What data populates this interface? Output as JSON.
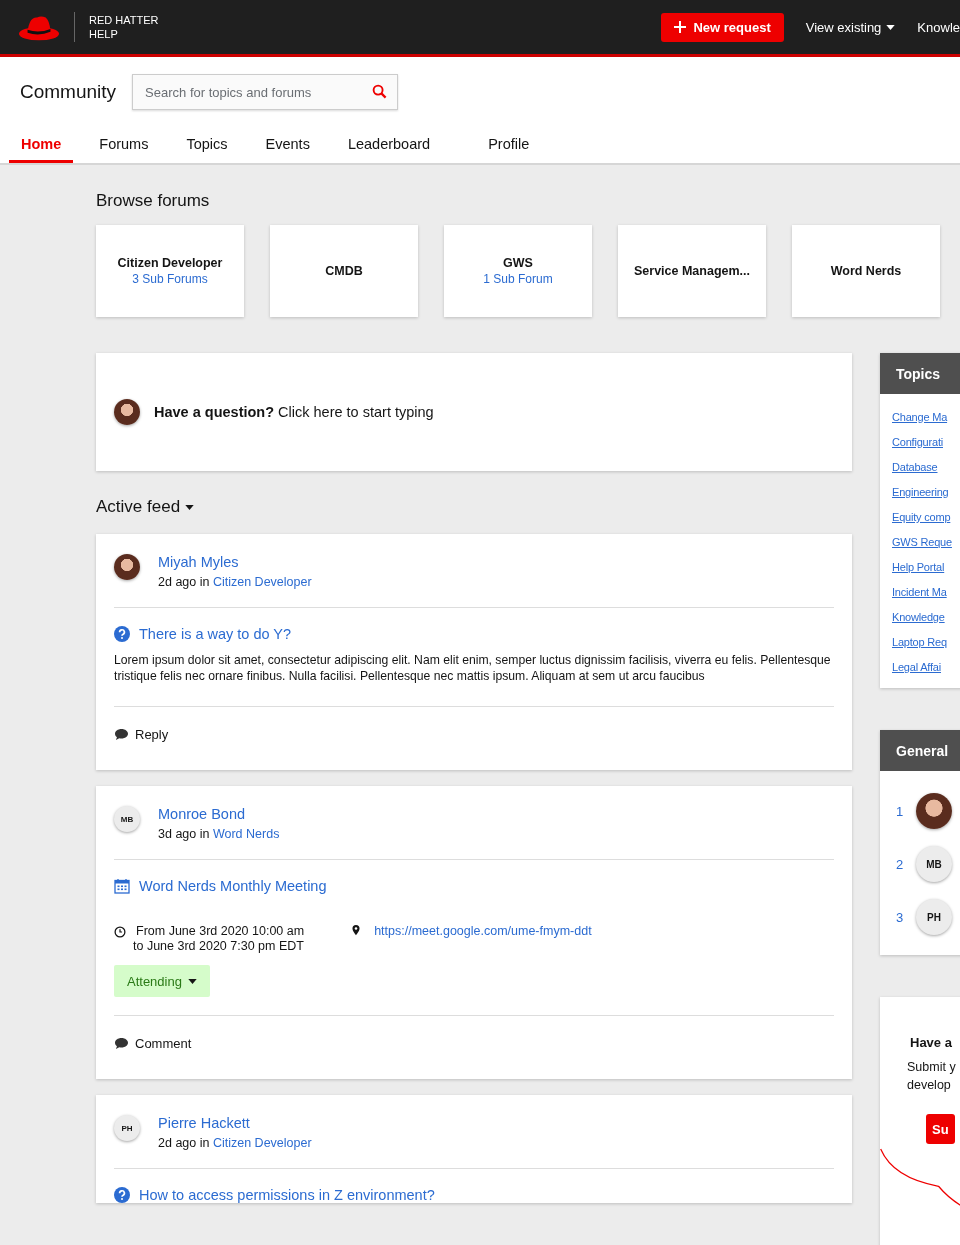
{
  "header": {
    "brand_lines": [
      "RED HATTER",
      "HELP"
    ],
    "new_request": "New request",
    "nav": [
      {
        "label": "View existing",
        "dropdown": true
      },
      {
        "label": "Knowle",
        "dropdown": false
      }
    ]
  },
  "community": {
    "title": "Community",
    "search": {
      "placeholder": "Search for topics and forums"
    }
  },
  "tabs": [
    {
      "label": "Home",
      "selected": true
    },
    {
      "label": "Forums",
      "selected": false
    },
    {
      "label": "Topics",
      "selected": false
    },
    {
      "label": "Events",
      "selected": false
    },
    {
      "label": "Leaderboard",
      "selected": false
    },
    {
      "label": "Profile",
      "selected": false
    }
  ],
  "browse": {
    "title": "Browse forums",
    "forums": [
      {
        "name": "Citizen Developer",
        "sub": "3 Sub Forums"
      },
      {
        "name": "CMDB"
      },
      {
        "name": "GWS",
        "sub": "1 Sub Forum"
      },
      {
        "name": "Service Managem..."
      },
      {
        "name": "Word Nerds"
      }
    ]
  },
  "ask": {
    "prompt": "**Have a question?** Click here to start typing"
  },
  "feed": {
    "title": "Active feed",
    "posts": [
      {
        "kind": "question",
        "author": "Miyah Myles",
        "time": "2d ago in",
        "forum": "Citizen Developer",
        "title": "There is a way to do Y?",
        "body": "Lorem ipsum dolor sit amet, consectetur adipiscing elit. Nam elit enim, semper luctus dignissim facilisis, viverra eu felis. Pellentesque tristique felis nec ornare finibus. Nulla facilisi. Pellentesque nec mattis ipsum. Aliquam at sem ut arcu faucibus",
        "action": "Reply"
      },
      {
        "kind": "event",
        "author": "Monroe Bond",
        "initials": "MB",
        "time": "3d ago in",
        "forum": "Word Nerds",
        "title": "Word Nerds Monthly Meeting",
        "from": "From June 3rd 2020 10:00 am",
        "to": "to June 3rd 2020 7:30 pm EDT",
        "link": "https://meet.google.com/ume-fmym-ddt",
        "rsvp": "Attending",
        "action": "Comment"
      },
      {
        "kind": "question",
        "author": "Pierre Hackett",
        "initials": "PH",
        "time": "2d ago in",
        "forum": "Citizen Developer",
        "title": "How to access permissions in Z environment?"
      }
    ]
  },
  "sidebar": {
    "topics": {
      "title": "Topics",
      "items": [
        "Change Ma",
        "Configurati",
        "Database",
        "Engineering",
        "Equity comp",
        "GWS Reque",
        "Help Portal",
        "Incident Ma",
        "Knowledge",
        "Laptop Req",
        "Legal Affai"
      ]
    },
    "leaders": {
      "title": "General",
      "rows": [
        {
          "rank": "1"
        },
        {
          "rank": "2",
          "initials": "MB"
        },
        {
          "rank": "3",
          "initials": "PH"
        }
      ]
    },
    "promo": {
      "title": "Have a",
      "lines": [
        "Submit y",
        "develop"
      ],
      "button": "Su"
    }
  }
}
